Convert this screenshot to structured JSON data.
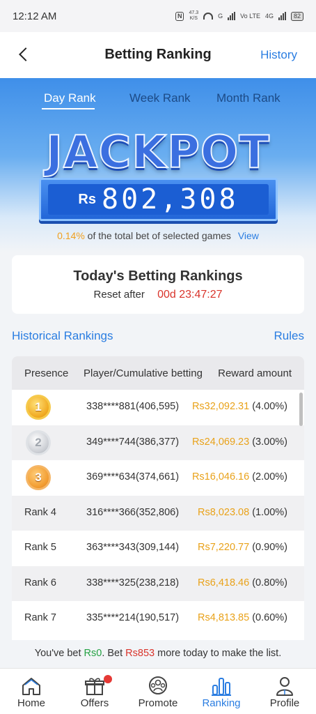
{
  "status_bar": {
    "time": "12:12 AM",
    "speed_top": "47.3",
    "speed_bottom": "K/S",
    "nfc": "N",
    "net1": "G",
    "net2": "Vo LTE",
    "net3": "4G",
    "battery": "82"
  },
  "header": {
    "title": "Betting Ranking",
    "history_label": "History"
  },
  "tabs": [
    {
      "label": "Day Rank",
      "active": true
    },
    {
      "label": "Week Rank",
      "active": false
    },
    {
      "label": "Month Rank",
      "active": false
    }
  ],
  "jackpot": {
    "word": "JACKPOT",
    "currency": "Rs",
    "amount": "802,308",
    "percent": "0.14%",
    "description": "of the total bet of selected games",
    "view_label": "View"
  },
  "today": {
    "title": "Today's Betting Rankings",
    "reset_label": "Reset after",
    "countdown": "00d 23:47:27"
  },
  "links": {
    "historical": "Historical Rankings",
    "rules": "Rules"
  },
  "table": {
    "headers": [
      "Presence",
      "Player/Cumulative betting",
      "Reward amount"
    ],
    "rows": [
      {
        "presence": "1",
        "medal": "gold",
        "player": "338****881(406,595)",
        "amount": "Rs32,092.31",
        "pct": "(4.00%)"
      },
      {
        "presence": "2",
        "medal": "silver",
        "player": "349****744(386,377)",
        "amount": "Rs24,069.23",
        "pct": "(3.00%)"
      },
      {
        "presence": "3",
        "medal": "bronze",
        "player": "369****634(374,661)",
        "amount": "Rs16,046.16",
        "pct": "(2.00%)"
      },
      {
        "presence": "Rank 4",
        "medal": "",
        "player": "316****366(352,806)",
        "amount": "Rs8,023.08",
        "pct": "(1.00%)"
      },
      {
        "presence": "Rank 5",
        "medal": "",
        "player": "363****343(309,144)",
        "amount": "Rs7,220.77",
        "pct": "(0.90%)"
      },
      {
        "presence": "Rank 6",
        "medal": "",
        "player": "338****325(238,218)",
        "amount": "Rs6,418.46",
        "pct": "(0.80%)"
      },
      {
        "presence": "Rank 7",
        "medal": "",
        "player": "335****214(190,517)",
        "amount": "Rs4,813.85",
        "pct": "(0.60%)"
      }
    ]
  },
  "bet_note": {
    "part1": "You've bet ",
    "bet_amount": "Rs0",
    "part2": ". Bet ",
    "need_amount": "Rs853",
    "part3": " more today to make the list."
  },
  "bottom_nav": [
    {
      "label": "Home",
      "icon": "home-icon",
      "active": false
    },
    {
      "label": "Offers",
      "icon": "gift-icon",
      "active": false,
      "badge": true
    },
    {
      "label": "Promote",
      "icon": "promote-icon",
      "active": false
    },
    {
      "label": "Ranking",
      "icon": "ranking-icon",
      "active": true
    },
    {
      "label": "Profile",
      "icon": "profile-icon",
      "active": false
    }
  ],
  "colors": {
    "accent": "#2a7de1",
    "gold_text": "#e9a21a",
    "countdown_red": "#d9342b",
    "bet_green": "#25a244"
  }
}
